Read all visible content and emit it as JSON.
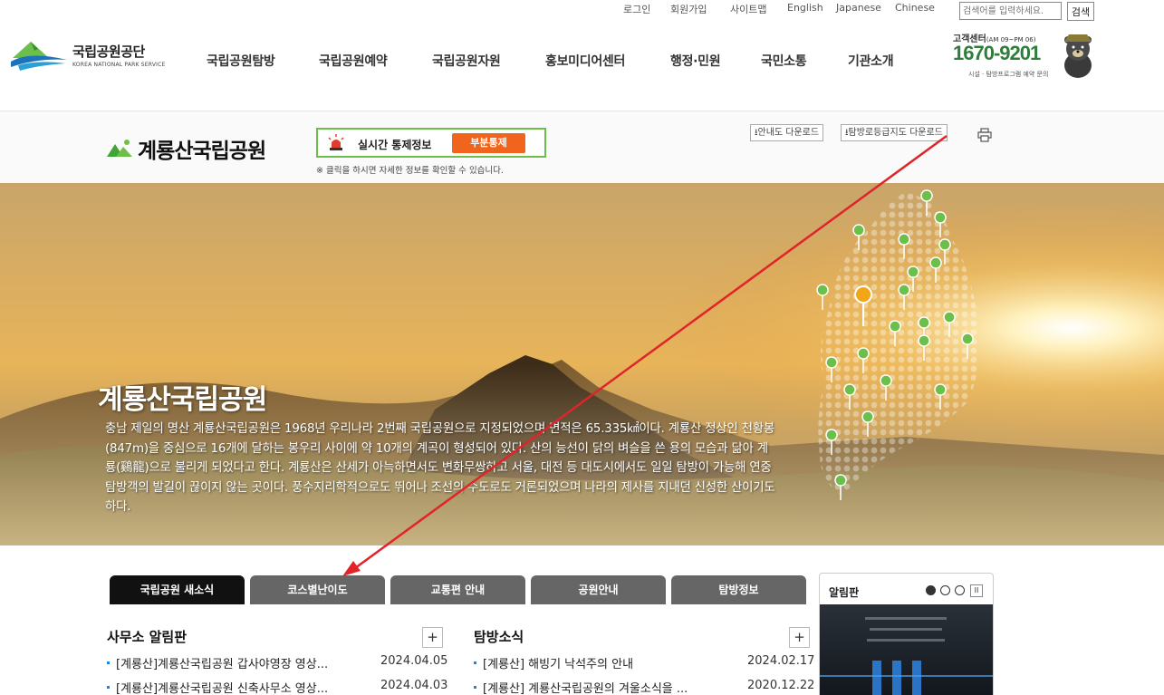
{
  "util": {
    "login": "로그인",
    "signup": "회원가입",
    "sitemap": "사이트맵",
    "english": "English",
    "japanese": "Japanese",
    "chinese": "Chinese",
    "search_placeholder": "검색어를 입력하세요.",
    "search_button": "검색"
  },
  "logo": {
    "name": "국립공원공단",
    "sub": "KOREA NATIONAL PARK SERVICE"
  },
  "nav": [
    "국립공원탐방",
    "국립공원예약",
    "국립공원자원",
    "홍보미디어센터",
    "행정·민원",
    "국민소통",
    "기관소개"
  ],
  "customer_center": {
    "title": "고객센터",
    "hours": "(AM 09~PM 06)",
    "phone": "1670-9201",
    "desc": "시설 · 탐방프로그램 예약 문의"
  },
  "park": {
    "title": "계룡산국립공원",
    "control_label": "실시간 통제정보",
    "control_status": "부분통제",
    "control_note": "※ 클릭을 하시면 자세한 정보를 확인할 수 있습니다.",
    "download_guide": "안내도 다운로드",
    "download_trail": "탐방로등급지도 다운로드"
  },
  "hero": {
    "title": "계룡산국립공원",
    "description": "충남 제일의 명산 계룡산국립공원은 1968년 우리나라 2번째 국립공원으로 지정되었으며 면적은 65.335㎢이다. 계룡산 정상인 천황봉(847m)을 중심으로 16개에 달하는 봉우리 사이에 약 10개의 계곡이 형성되어 있다. 산의 능선이 닭의 벼슬을 쓴 용의 모습과 닮아 계룡(鷄龍)으로 불리게 되었다고 한다. 계룡산은 산세가 아늑하면서도 변화무쌍하고 서울, 대전 등 대도시에서도 일일 탐방이 가능해 연중 탐방객의 발길이 끊이지 않는 곳이다. 풍수지리학적으로도 뛰어나 조선의 수도로도 거론되었으며 나라의 제사를 지내던 신성한 산이기도 하다."
  },
  "tabs": [
    "국립공원 새소식",
    "코스별난이도",
    "교통편 안내",
    "공원안내",
    "탐방정보"
  ],
  "office_board": {
    "title": "사무소 알림판",
    "plus": "+",
    "items": [
      {
        "title": "[계룡산]계룡산국립공원 갑사야영장 영상...",
        "date": "2024.04.05"
      },
      {
        "title": "[계룡산]계룡산국립공원 신축사무소 영상...",
        "date": "2024.04.03"
      }
    ]
  },
  "news_board": {
    "title": "탐방소식",
    "plus": "+",
    "items": [
      {
        "title": "[계룡산] 해빙기 낙석주의 안내",
        "date": "2024.02.17"
      },
      {
        "title": "[계룡산] 계룡산국립공원의 겨울소식을 ...",
        "date": "2020.12.22"
      }
    ]
  },
  "notice_widget": {
    "title": "알림판",
    "pause": "II"
  },
  "colors": {
    "accent_green": "#6cbf4a",
    "control_orange": "#f0641e",
    "tab_active": "#111111",
    "tab_inactive": "#666666",
    "annotation_arrow": "#e0242a"
  }
}
